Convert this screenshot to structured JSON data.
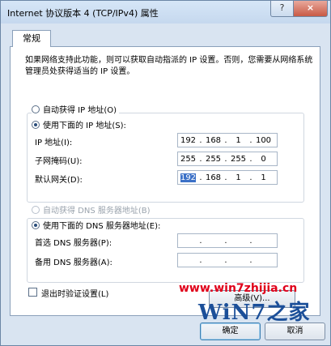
{
  "window": {
    "title": "Internet 协议版本 4 (TCP/IPv4) 属性",
    "help_label": "?",
    "close_label": "×"
  },
  "tabs": [
    "常规"
  ],
  "description": "如果网络支持此功能，则可以获取自动指派的 IP 设置。否则，您需要从网络系统管理员处获得适当的 IP 设置。",
  "ip": {
    "auto_label": "自动获得 IP 地址(O)",
    "manual_label": "使用下面的 IP 地址(S):",
    "selected": "manual",
    "fields": [
      {
        "label": "IP 地址(I):",
        "octets": [
          "192",
          "168",
          "1",
          "100"
        ]
      },
      {
        "label": "子网掩码(U):",
        "octets": [
          "255",
          "255",
          "255",
          "0"
        ]
      },
      {
        "label": "默认网关(D):",
        "octets": [
          "192",
          "168",
          "1",
          "1"
        ]
      }
    ]
  },
  "dns": {
    "auto_label": "自动获得 DNS 服务器地址(B)",
    "manual_label": "使用下面的 DNS 服务器地址(E):",
    "selected": "manual",
    "fields": [
      {
        "label": "首选 DNS 服务器(P):",
        "octets": [
          "",
          "",
          "",
          ""
        ]
      },
      {
        "label": "备用 DNS 服务器(A):",
        "octets": [
          "",
          "",
          "",
          ""
        ]
      }
    ]
  },
  "validate_label": "退出时验证设置(L)",
  "validate_checked": false,
  "buttons": {
    "advanced": "高级(V)...",
    "ok": "确定",
    "cancel": "取消"
  },
  "watermark": {
    "url": "www.win7zhijia.cn",
    "logo": "WiN7之家"
  }
}
